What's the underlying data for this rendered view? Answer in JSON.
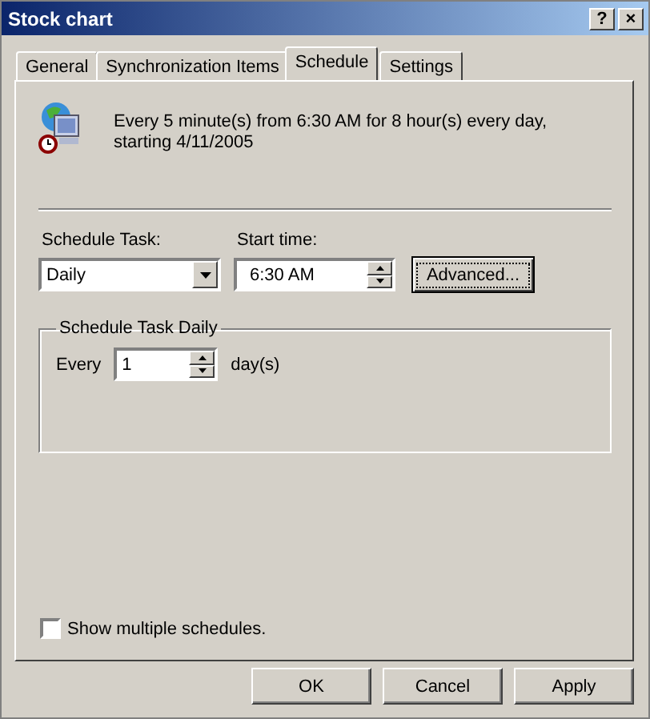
{
  "window": {
    "title": "Stock chart",
    "buttons": [
      "?",
      "×"
    ]
  },
  "tabs": [
    {
      "label": "General",
      "selected": false
    },
    {
      "label": "Synchronization Items",
      "selected": false
    },
    {
      "label": "Schedule",
      "selected": true
    },
    {
      "label": "Settings",
      "selected": false
    }
  ],
  "summary": "Every 5 minute(s) from 6:30 AM for 8 hour(s) every day, starting 4/11/2005",
  "schedule_task": {
    "label": "Schedule Task:",
    "value": "Daily"
  },
  "start_time": {
    "label": "Start time:",
    "value": "6:30 AM"
  },
  "advanced_button": "Advanced...",
  "group": {
    "title": "Schedule Task Daily",
    "every_label": "Every",
    "every_value": "1",
    "unit": "day(s)"
  },
  "show_multiple": {
    "label": "Show multiple schedules.",
    "checked": false
  },
  "buttons": [
    "OK",
    "Cancel",
    "Apply"
  ]
}
